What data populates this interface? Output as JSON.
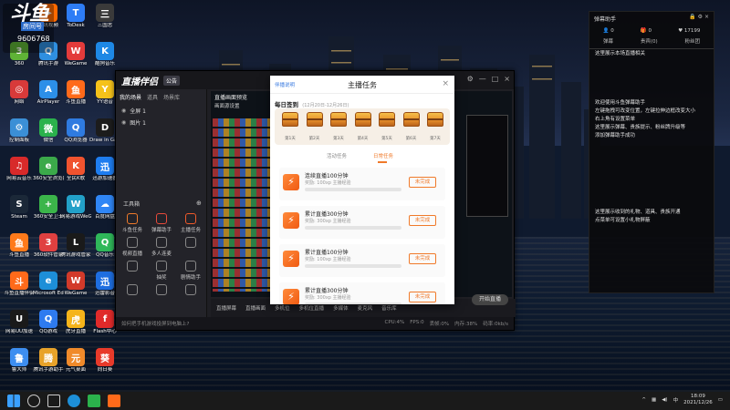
{
  "room": {
    "label": "房间号",
    "number": "9606768"
  },
  "desktop_icons": [
    {
      "label": "可牛",
      "color": "#3a6fd8",
      "glyph": "K"
    },
    {
      "label": "腾讯视频",
      "color": "#ff6a00",
      "glyph": "▶"
    },
    {
      "label": "ToDesk",
      "color": "#2e7df6",
      "glyph": "T"
    },
    {
      "label": "三国志",
      "color": "#3a3a3a",
      "glyph": "三"
    },
    {
      "label": "360",
      "color": "#5fb336",
      "glyph": "3"
    },
    {
      "label": "腾讯手游",
      "color": "#2f8fe0",
      "glyph": "Q"
    },
    {
      "label": "WeGame",
      "color": "#e33b3b",
      "glyph": "W"
    },
    {
      "label": "酷狗音乐",
      "color": "#1e88e5",
      "glyph": "K"
    },
    {
      "label": "网络",
      "color": "#d83a3a",
      "glyph": "◎"
    },
    {
      "label": "AirPlayer",
      "color": "#2c8fe8",
      "glyph": "A"
    },
    {
      "label": "斗鱼直播",
      "color": "#ff6a1a",
      "glyph": "鱼"
    },
    {
      "label": "YY语音",
      "color": "#f5c21a",
      "glyph": "Y"
    },
    {
      "label": "控制面板",
      "color": "#3b8fd6",
      "glyph": "⚙"
    },
    {
      "label": "微信",
      "color": "#2bb24c",
      "glyph": "微"
    },
    {
      "label": "QQ浏览器",
      "color": "#2f7be0",
      "glyph": "Q"
    },
    {
      "label": "Draw in Games",
      "color": "#1c1c1c",
      "glyph": "D"
    },
    {
      "label": "网易云音乐",
      "color": "#d82a2a",
      "glyph": "♫"
    },
    {
      "label": "360安全浏览器",
      "color": "#3ba94a",
      "glyph": "e"
    },
    {
      "label": "全民K歌",
      "color": "#f0532f",
      "glyph": "K"
    },
    {
      "label": "迅游加速器",
      "color": "#1e7df0",
      "glyph": "迅"
    },
    {
      "label": "Steam",
      "color": "#1b2838",
      "glyph": "S"
    },
    {
      "label": "360安全卫士",
      "color": "#3bb54a",
      "glyph": "+"
    },
    {
      "label": "网易游戏WeGame",
      "color": "#22a0c8",
      "glyph": "W"
    },
    {
      "label": "百度网盘",
      "color": "#2f86f6",
      "glyph": "☁"
    },
    {
      "label": "斗鱼直播",
      "color": "#ff7a1a",
      "glyph": "鱼"
    },
    {
      "label": "360软件管家",
      "color": "#e04040",
      "glyph": "3"
    },
    {
      "label": "腾讯游戏管家",
      "color": "#1a1a1a",
      "glyph": "L"
    },
    {
      "label": "QQ音乐",
      "color": "#2fb85a",
      "glyph": "Q"
    },
    {
      "label": "斗鱼直播伴侣",
      "color": "#ff6a1a",
      "glyph": "斗"
    },
    {
      "label": "Microsoft Edge",
      "color": "#1d8fd8",
      "glyph": "e"
    },
    {
      "label": "WeGame",
      "color": "#d23a2a",
      "glyph": "W"
    },
    {
      "label": "迅雷影音",
      "color": "#1e6ee0",
      "glyph": "迅"
    },
    {
      "label": "网易UU加速",
      "color": "#1a1a1a",
      "glyph": "U"
    },
    {
      "label": "QQ游戏",
      "color": "#2e7bf0",
      "glyph": "Q"
    },
    {
      "label": "虎牙直播",
      "color": "#f5b41a",
      "glyph": "虎"
    },
    {
      "label": "Flash中心",
      "color": "#e02a2a",
      "glyph": "f"
    },
    {
      "label": "鲁大师",
      "color": "#3d8ef0",
      "glyph": "鲁"
    },
    {
      "label": "腾讯手游助手",
      "color": "#e8a32a",
      "glyph": "腾"
    },
    {
      "label": "元气桌面",
      "color": "#f08a2a",
      "glyph": "元"
    },
    {
      "label": "向日葵",
      "color": "#e83a2a",
      "glyph": "葵"
    }
  ],
  "app": {
    "brand": "直播伴侣",
    "badge": "公告",
    "tabs": [
      "我的场景",
      "道具",
      "场景库"
    ],
    "scenes": [
      "全屏 1",
      "图片 1"
    ],
    "preview_line1": "直播画面预览",
    "preview_line2": "画面源设置",
    "tools_title": "工具箱",
    "tools": [
      "斗鱼任务",
      "弹幕助手",
      "主播任务",
      "视频直播",
      "多人连麦",
      "",
      "",
      "抽奖",
      "剧情助手",
      "",
      "",
      ""
    ],
    "bottom_items": [
      "直播屏幕",
      "直播画面",
      "多机位",
      "多机位直播",
      "多媒体",
      "麦克风",
      "音乐库"
    ],
    "live_button": "开始直播",
    "status_left": "如何把手机游戏投屏到电脑上?",
    "status_stats": [
      "CPU:4%",
      "FPS:0",
      "丢帧:0%",
      "内存:38%",
      "码率:0kb/s"
    ]
  },
  "modal": {
    "help": "伴播说明",
    "title": "主播任务",
    "close": "×",
    "checkin_title": "每日签到",
    "checkin_sub": "(12月20日-12月26日)",
    "days": [
      "第1天",
      "第2天",
      "第3天",
      "第4天",
      "第5天",
      "第6天",
      "第7天"
    ],
    "tabs": [
      "活动任务",
      "日常任务"
    ],
    "active_tab": "日常任务",
    "tasks": [
      {
        "name": "连续直播100分钟",
        "reward": "奖励: 100xp 主播经验",
        "progress": 0.0,
        "button": "未完成"
      },
      {
        "name": "累计直播300分钟",
        "reward": "奖励: 300xp 主播经验",
        "progress": 0.0,
        "button": "未完成"
      },
      {
        "name": "累计直播100分钟",
        "reward": "奖励: 100xp 主播经验",
        "progress": 0.0,
        "button": "未完成"
      },
      {
        "name": "累计直播300分钟",
        "reward": "奖励: 300xp 主播经验",
        "progress": 0.0,
        "button": "未完成"
      }
    ]
  },
  "chat": {
    "title": "弹幕助手",
    "stats": [
      "0",
      "0",
      "17199"
    ],
    "tabs": [
      "弹幕",
      "贵宾(0)",
      "粉丝团"
    ],
    "messages": [
      "这里展示本场直播相关",
      "欢迎使用斗鱼弹幕助手\n左键拖拽可改变位置，左键拉伸边框改变大小\n右上角有设置菜单\n这里展示弹幕、贵族提示、粉丝牌升级等\n添加弹幕助手成功",
      "这里展示收到的礼物、道具、贵族开通\n点菜单可设置小礼物屏蔽"
    ]
  },
  "taskbar": {
    "time": "18:09",
    "date": "2021/12/26",
    "lang": "中"
  }
}
